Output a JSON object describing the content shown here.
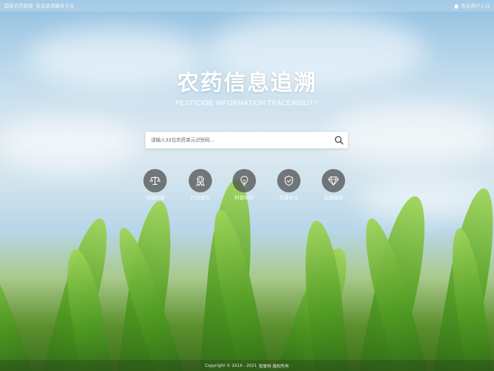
{
  "topbar": {
    "left_text_1": "国家农药管理",
    "left_text_2": "信息追溯服务平台",
    "right_text": "农业用户入口"
  },
  "hero": {
    "title_cn": "农药信息追溯",
    "title_en": "PESTICIDE INFORMATION TRACEABILITY"
  },
  "search": {
    "placeholder": "请输入32位农药单元识别码...",
    "value": ""
  },
  "features": [
    {
      "label": "法规标准",
      "icon": "scale-icon"
    },
    {
      "label": "行业资讯",
      "icon": "award-icon"
    },
    {
      "label": "科普知识",
      "icon": "lightbulb-icon"
    },
    {
      "label": "质量安全",
      "icon": "shield-icon"
    },
    {
      "label": "品牌推荐",
      "icon": "diamond-icon"
    }
  ],
  "footer": {
    "copyright": "Copyright © 2014 - 2021",
    "owner": "智联码 版权所有"
  }
}
